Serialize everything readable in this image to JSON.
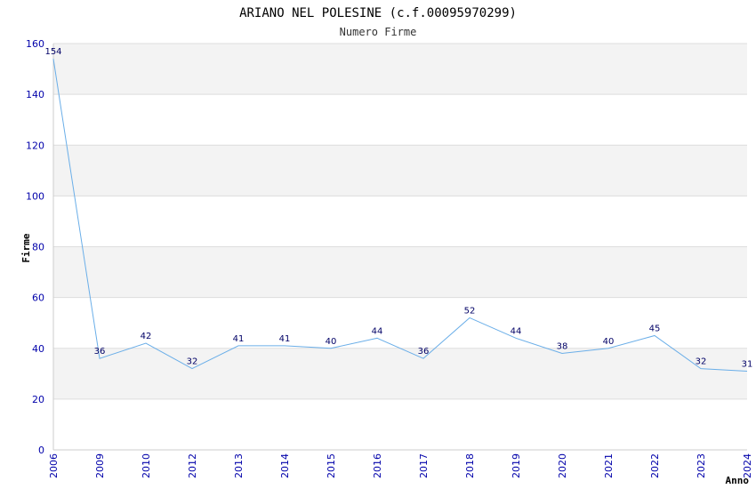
{
  "chart_data": {
    "type": "line",
    "title": "ARIANO NEL POLESINE (c.f.00095970299)",
    "subtitle": "Numero Firme",
    "xlabel": "Anno",
    "ylabel": "Firme",
    "categories": [
      "2006",
      "2009",
      "2010",
      "2012",
      "2013",
      "2014",
      "2015",
      "2016",
      "2017",
      "2018",
      "2019",
      "2020",
      "2021",
      "2022",
      "2023",
      "2024"
    ],
    "values": [
      154,
      36,
      42,
      32,
      41,
      41,
      40,
      44,
      36,
      52,
      44,
      38,
      40,
      45,
      32,
      31
    ],
    "ylim": [
      0,
      160
    ],
    "yticks": [
      0,
      20,
      40,
      60,
      80,
      100,
      120,
      140,
      160
    ],
    "grid": true,
    "colors": {
      "line": "#6aaee8",
      "band": "#f3f3f3",
      "grid": "#dddddd",
      "tick_text": "#0000aa",
      "data_label": "#000066"
    }
  }
}
